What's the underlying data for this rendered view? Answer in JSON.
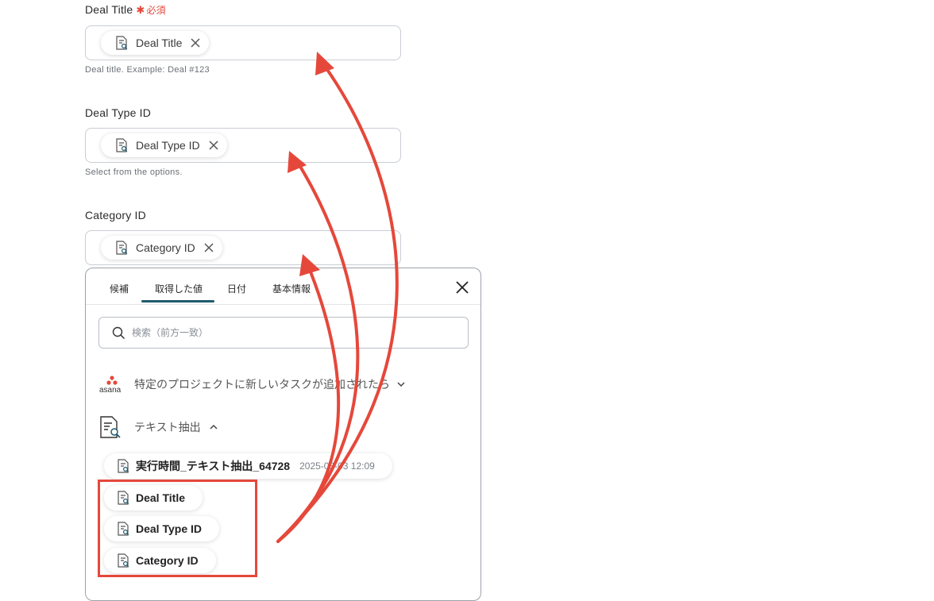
{
  "fields": [
    {
      "label": "Deal Title",
      "required_text": "必須",
      "chip": "Deal Title",
      "help": "Deal title. Example: Deal #123"
    },
    {
      "label": "Deal Type ID",
      "chip": "Deal Type ID",
      "help": "Select from the options."
    },
    {
      "label": "Category ID",
      "chip": "Category ID"
    }
  ],
  "popup": {
    "tabs": [
      "候補",
      "取得した値",
      "日付",
      "基本情報"
    ],
    "active_tab": "取得した値",
    "search_placeholder": "検索（前方一致）",
    "sections": [
      {
        "app": "asana",
        "title": "特定のプロジェクトに新しいタスクが追加されたら",
        "state": "collapsed"
      },
      {
        "app": "text-extract",
        "title": "テキスト抽出",
        "state": "expanded"
      }
    ],
    "items": [
      {
        "label": "実行時間_テキスト抽出_64728",
        "meta": "2025-03-03 12:09"
      },
      {
        "label": "Deal Title"
      },
      {
        "label": "Deal Type ID"
      },
      {
        "label": "Category ID"
      }
    ]
  },
  "colors": {
    "accent": "#1f5b6e",
    "annotation": "#e5483b",
    "required": "#e5483b"
  }
}
